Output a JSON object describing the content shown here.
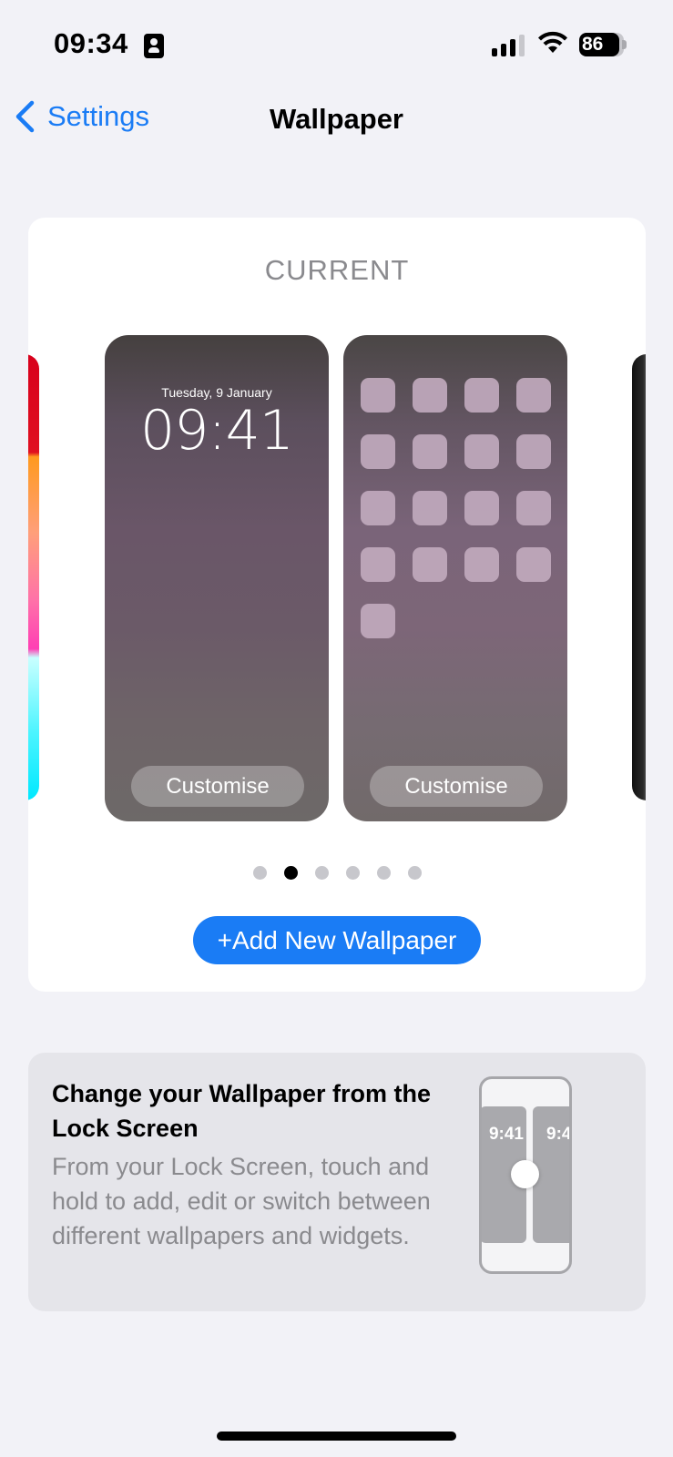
{
  "status_bar": {
    "time": "09:34",
    "battery": "86",
    "icons": [
      "contact-card-icon",
      "cellular-signal-icon",
      "wifi-icon",
      "battery-icon"
    ]
  },
  "nav": {
    "back_label": "Settings",
    "title": "Wallpaper"
  },
  "current_card": {
    "label": "CURRENT",
    "lock_screen": {
      "date": "Tuesday, 9 January",
      "time": "09:41",
      "customise_label": "Customise"
    },
    "home_screen": {
      "customise_label": "Customise",
      "app_icon_count": 17
    },
    "page_indicator": {
      "count": 6,
      "active_index": 1
    },
    "add_button_label": "+Add New Wallpaper"
  },
  "info_card": {
    "title": "Change your Wallpaper from the Lock Screen",
    "body": "From your Lock Screen, touch and hold to add, edit or switch between different wallpapers and widgets.",
    "illustration": {
      "left_time": "9:41",
      "right_time": "9:4"
    }
  },
  "colors": {
    "accent": "#1a7cf5",
    "background": "#f2f2f7",
    "card": "#ffffff",
    "secondary_text": "#8a8a8e"
  }
}
